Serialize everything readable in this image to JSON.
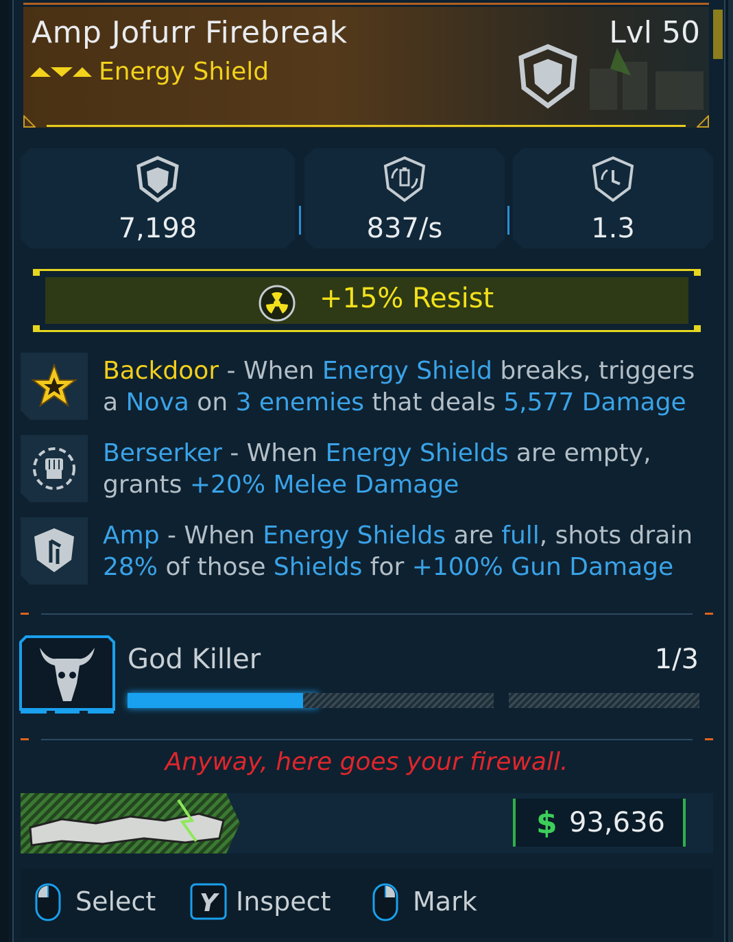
{
  "item": {
    "name": "Amp Jofurr Firebreak",
    "level": "Lvl 50",
    "type": "Energy Shield"
  },
  "stats": [
    {
      "icon": "shield-capacity-icon",
      "value": "7,198"
    },
    {
      "icon": "recharge-rate-icon",
      "value": "837/s"
    },
    {
      "icon": "recharge-delay-icon",
      "value": "1.3"
    }
  ],
  "resist": {
    "icon": "radiation-icon",
    "text": "+15% Resist"
  },
  "perks": {
    "p1": {
      "icon": "star-burst-icon",
      "name": "Backdoor",
      "sep": " - When ",
      "k1": "Energy Shield",
      "t1": " breaks, triggers a ",
      "k2": "Nova",
      "t2": " on ",
      "k3": "3 enemies",
      "t3": " that deals ",
      "k4": "5,577 Damage"
    },
    "p2": {
      "icon": "fist-icon",
      "name": "Berserker",
      "sep": " - When ",
      "k1": "Energy Shields",
      "t1": " are empty, grants ",
      "k2": "+20% Melee Damage"
    },
    "p3": {
      "icon": "amp-shield-icon",
      "name": "Amp",
      "sep": " - When ",
      "k1": "Energy Shields",
      "t1": " are ",
      "k2": "full",
      "t2": ", shots drain ",
      "k3": "28%",
      "t3": " of those ",
      "k4": "Shields",
      "t4": " for ",
      "k5": "+100% Gun Damage"
    }
  },
  "challenge": {
    "icon": "horned-skull-icon",
    "name": "God Killer",
    "count": "1/3",
    "progress": 0.333
  },
  "flavor": "Anyway, here goes your firewall.",
  "manufacturer": {
    "logo": "ripper-logo"
  },
  "price": {
    "symbol": "$",
    "value": "93,636"
  },
  "actions": [
    {
      "icon": "mouse-left-icon",
      "label": "Select"
    },
    {
      "icon": "y-key-icon",
      "label": "Inspect"
    },
    {
      "icon": "mouse-right-icon",
      "label": "Mark"
    }
  ],
  "colors": {
    "rarity": "#f2d21c",
    "keyword": "#3aa3e8",
    "flavor": "#e0262c",
    "price": "#3ccf5a"
  }
}
